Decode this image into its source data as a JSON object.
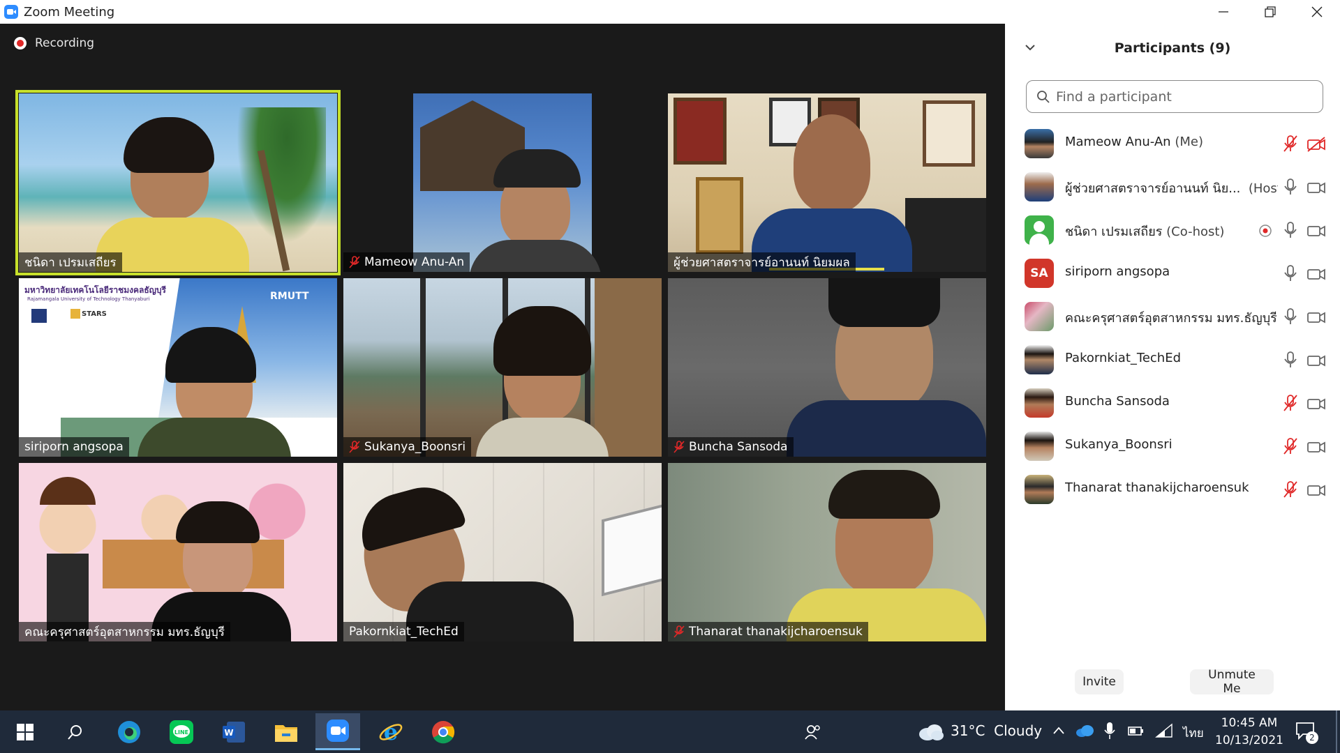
{
  "window": {
    "title": "Zoom Meeting"
  },
  "meeting": {
    "recording_label": "Recording"
  },
  "tiles": [
    {
      "name": "ชนิดา เปรมเสถียร",
      "muted": false,
      "active": true
    },
    {
      "name": "Mameow Anu-An",
      "muted": true,
      "active": false
    },
    {
      "name": "ผู้ช่วยศาสตราจารย์อานนท์ นิยมผล",
      "muted": false,
      "active": false
    },
    {
      "name": "siriporn angsopa",
      "muted": false,
      "active": false
    },
    {
      "name": "Sukanya_Boonsri",
      "muted": true,
      "active": false
    },
    {
      "name": "Buncha Sansoda",
      "muted": true,
      "active": false
    },
    {
      "name": "คณะครุศาสตร์อุตสาหกรรม มทร.ธัญบุรี",
      "muted": false,
      "active": false
    },
    {
      "name": "Pakornkiat_TechEd",
      "muted": false,
      "active": false
    },
    {
      "name": "Thanarat thanakijcharoensuk",
      "muted": true,
      "active": false
    }
  ],
  "slide_overlay": {
    "university_thai": "มหาวิทยาลัยเทคโนโลยีราชมงคลธัญบุรี",
    "university_en": "Rajamangala University of Technology Thanyaburi",
    "brand": "RMUTT",
    "badge": "STARS"
  },
  "panel": {
    "title": "Participants (9)",
    "search_placeholder": "Find a participant",
    "invite_label": "Invite",
    "unmute_label": "Unmute Me"
  },
  "participants": [
    {
      "name": "Mameow Anu-An",
      "role": "(Me)",
      "mic": "muted",
      "video": "off",
      "avatar": "photo"
    },
    {
      "name": "ผู้ช่วยศาสตราจารย์อานนท์ นิย...",
      "role": "(Host)",
      "mic": "on",
      "video": "on",
      "avatar": "photo"
    },
    {
      "name": "ชนิดา เปรมเสถียร",
      "role": "(Co-host)",
      "mic": "on",
      "video": "on",
      "avatar": "default",
      "recording": true
    },
    {
      "name": "siriporn angsopa",
      "role": "",
      "mic": "on",
      "video": "on",
      "avatar": "initials",
      "initials": "SA"
    },
    {
      "name": "คณะครุศาสตร์อุตสาหกรรม มทร.ธัญบุรี",
      "role": "",
      "mic": "on",
      "video": "on",
      "avatar": "photo"
    },
    {
      "name": "Pakornkiat_TechEd",
      "role": "",
      "mic": "on",
      "video": "on",
      "avatar": "photo"
    },
    {
      "name": "Buncha Sansoda",
      "role": "",
      "mic": "muted",
      "video": "on",
      "avatar": "photo"
    },
    {
      "name": "Sukanya_Boonsri",
      "role": "",
      "mic": "muted",
      "video": "on",
      "avatar": "photo"
    },
    {
      "name": "Thanarat thanakijcharoensuk",
      "role": "",
      "mic": "muted",
      "video": "on",
      "avatar": "photo"
    }
  ],
  "taskbar": {
    "apps": [
      "start-icon",
      "search-icon",
      "edge-icon",
      "line-icon",
      "word-icon",
      "file-explorer-icon",
      "zoom-icon",
      "internet-explorer-icon",
      "chrome-icon"
    ],
    "weather": "31°C  Cloudy",
    "language": "ไทย",
    "time": "10:45 AM",
    "date": "10/13/2021",
    "notifications": "2"
  },
  "colors": {
    "active_speaker": "#c7e02a",
    "muted_red": "#e02828",
    "panel_bg": "#ffffff",
    "video_bg": "#1a1a1a",
    "taskbar_bg": "#1f2a3a"
  }
}
